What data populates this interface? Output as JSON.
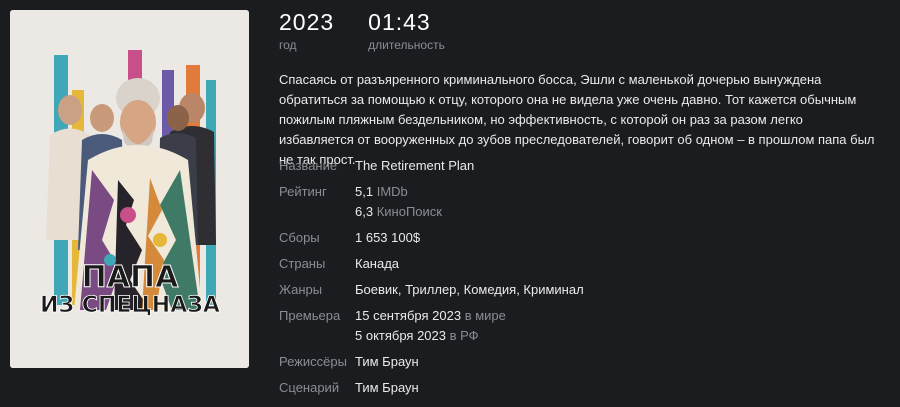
{
  "poster": {
    "title_line1": "ПАПА",
    "title_line2": "ИЗ СПЕЦНАЗА",
    "stripe_colors": [
      "#3fa7b5",
      "#e6b83a",
      "#c94f8a",
      "#6c5aa8",
      "#e27a3c"
    ]
  },
  "stats": {
    "year_value": "2023",
    "year_label": "год",
    "duration_value": "01:43",
    "duration_label": "длительность"
  },
  "description": "Спасаясь от разъяренного криминального босса, Эшли с маленькой дочерью вынуждена обратиться за помощью к отцу, которого она не видела уже очень давно. Тот кажется обычным пожилым пляжным бездельником, но эффективность, с которой он раз за разом легко избавляется от вооруженных до зубов преследователей, говорит об одном – в прошлом папа был не так прост.",
  "info": {
    "title_label": "Название",
    "title_value": "The Retirement Plan",
    "rating_label": "Рейтинг",
    "imdb_value": "5,1",
    "imdb_source": "IMDb",
    "kp_value": "6,3",
    "kp_source": "КиноПоиск",
    "boxoffice_label": "Сборы",
    "boxoffice_value": "1 653 100$",
    "countries_label": "Страны",
    "countries_value": "Канада",
    "genres_label": "Жанры",
    "genres_value": "Боевик, Триллер, Комедия, Криминал",
    "premiere_label": "Премьера",
    "premiere_world_date": "15 сентября 2023",
    "premiere_world_suffix": "в мире",
    "premiere_ru_date": "5 октября 2023",
    "premiere_ru_suffix": "в РФ",
    "directors_label": "Режиссёры",
    "directors_value": "Тим Браун",
    "writers_label": "Сценарий",
    "writers_value": "Тим Браун"
  }
}
